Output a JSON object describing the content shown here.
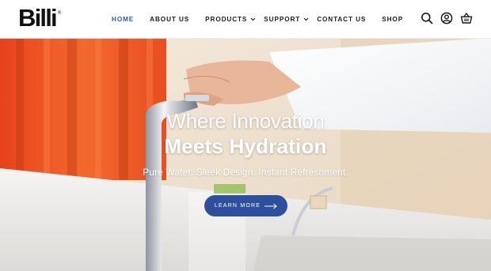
{
  "brand": {
    "logo_text": "Billi",
    "logo_mark": "®"
  },
  "nav": {
    "items": [
      {
        "label": "HOME",
        "active": true,
        "has_dropdown": false
      },
      {
        "label": "ABOUT US",
        "active": false,
        "has_dropdown": false
      },
      {
        "label": "PRODUCTS",
        "active": false,
        "has_dropdown": true
      },
      {
        "label": "SUPPORT",
        "active": false,
        "has_dropdown": true
      },
      {
        "label": "CONTACT US",
        "active": false,
        "has_dropdown": false
      },
      {
        "label": "SHOP",
        "active": false,
        "has_dropdown": false
      }
    ],
    "icons": [
      "search-icon",
      "account-icon",
      "cart-icon"
    ]
  },
  "hero": {
    "title_line1": "Where Innovation",
    "title_line2": "Meets Hydration",
    "subtitle": "Pure Water. Sleek Design. Instant Refreshment.",
    "cta_label": "LEARN MORE"
  },
  "colors": {
    "accent": "#2e4f9e",
    "nav_active": "#2a5db0",
    "text_dark": "#1f1f1f"
  }
}
